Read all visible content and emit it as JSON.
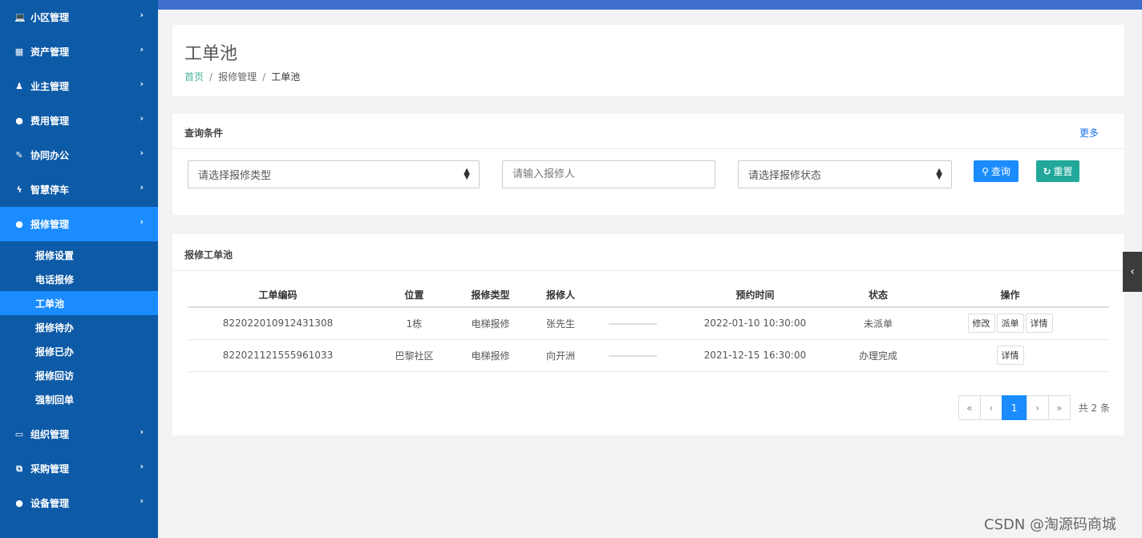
{
  "sidebar": {
    "items": [
      {
        "label": "小区管理",
        "icon": "laptop-icon",
        "glyph": "💻"
      },
      {
        "label": "资产管理",
        "icon": "grid-icon",
        "glyph": "▦"
      },
      {
        "label": "业主管理",
        "icon": "user-icon",
        "glyph": "♟"
      },
      {
        "label": "费用管理",
        "icon": "globe-icon",
        "glyph": "●"
      },
      {
        "label": "协同办公",
        "icon": "edit-icon",
        "glyph": "✎"
      },
      {
        "label": "智慧停车",
        "icon": "bolt-icon",
        "glyph": "ϟ"
      },
      {
        "label": "报修管理",
        "icon": "globe-icon",
        "glyph": "●"
      }
    ],
    "subitems": [
      {
        "label": "报修设置"
      },
      {
        "label": "电话报修"
      },
      {
        "label": "工单池"
      },
      {
        "label": "报修待办"
      },
      {
        "label": "报修已办"
      },
      {
        "label": "报修回访"
      },
      {
        "label": "强制回单"
      }
    ],
    "items_after": [
      {
        "label": "组织管理",
        "icon": "monitor-icon",
        "glyph": "▭"
      },
      {
        "label": "采购管理",
        "icon": "copy-icon",
        "glyph": "⧉"
      },
      {
        "label": "设备管理",
        "icon": "globe-icon",
        "glyph": "●"
      }
    ],
    "chevron": "›"
  },
  "header": {
    "title": "工单池",
    "breadcrumb": {
      "home": "首页",
      "sep1": "/",
      "mid": "报修管理",
      "sep2": "/",
      "current": "工单池"
    }
  },
  "query": {
    "title": "查询条件",
    "more": "更多",
    "repair_type_placeholder": "请选择报修类型",
    "repairer_placeholder": "请输入报修人",
    "status_placeholder": "请选择报修状态",
    "query_button": "查询",
    "reset_button": "重置"
  },
  "table": {
    "title": "报修工单池",
    "columns": [
      "工单编码",
      "位置",
      "报修类型",
      "报修人",
      "",
      "预约时间",
      "状态",
      "操作"
    ],
    "rows": [
      {
        "code": "822022010912431308",
        "location": "1栋",
        "type": "电梯报修",
        "person": "张先生",
        "time": "2022-01-10 10:30:00",
        "status": "未派单",
        "actions": [
          "修改",
          "派单",
          "详情"
        ]
      },
      {
        "code": "822021121555961033",
        "location": "巴黎社区",
        "type": "电梯报修",
        "person": "向开洲",
        "time": "2021-12-15 16:30:00",
        "status": "办理完成",
        "actions": [
          "详情"
        ]
      }
    ]
  },
  "pagination": {
    "first": "«",
    "prev": "‹",
    "current": "1",
    "next": "›",
    "last": "»",
    "total": "共 2 条"
  },
  "side_tab": "‹",
  "watermark": "CSDN @淘源码商城",
  "colors": {
    "sidebar": "#0d5aa7",
    "active": "#1a8cff",
    "topbar": "#3d6ed0",
    "reset": "#21a89a",
    "link": "#47b39c"
  }
}
